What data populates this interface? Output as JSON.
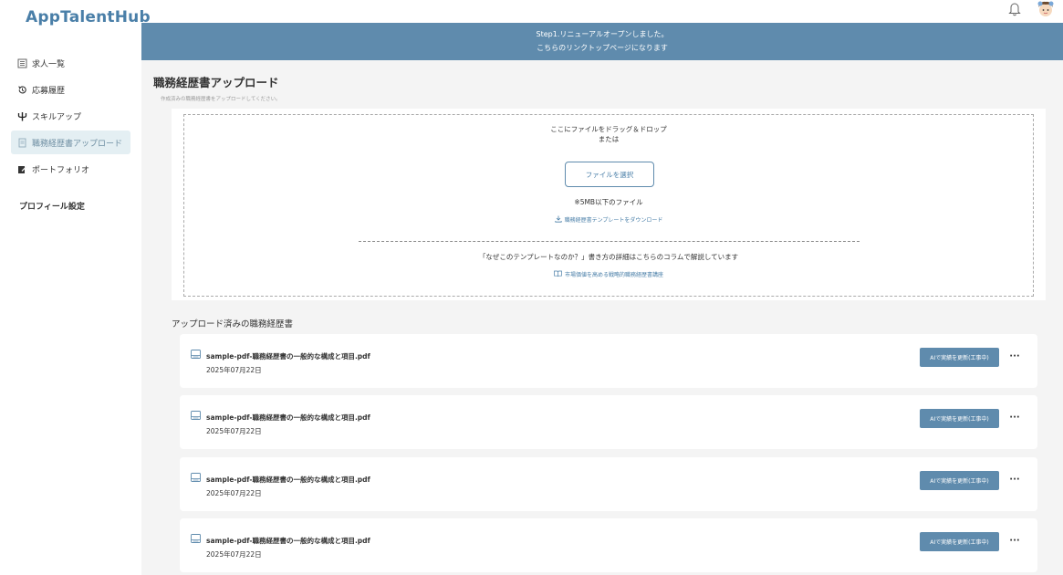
{
  "app": {
    "title": "AppTalentHub"
  },
  "sidebar": {
    "items": [
      {
        "label": "求人一覧",
        "icon": "building-icon"
      },
      {
        "label": "応募履歴",
        "icon": "history-icon"
      },
      {
        "label": "スキルアップ",
        "icon": "trident-icon"
      },
      {
        "label": "職務経歴書アップロード",
        "icon": "document-upload-icon",
        "active": true
      },
      {
        "label": "ポートフォリオ",
        "icon": "edit-icon"
      }
    ],
    "profile_label": "プロフィール設定"
  },
  "banner": {
    "line1": "Step1.リニューアルオープンしました。",
    "line2": "こちらのリンクトップページになります"
  },
  "page": {
    "title": "職務経歴書アップロード",
    "subtitle": "作成済みの職務経歴書をアップロードしてください。"
  },
  "upload": {
    "drag_text": "ここにファイルをドラッグ＆ドロップ",
    "or_text": "または",
    "select_button": "ファイルを選択",
    "limit_text": "※5MB以下のファイル",
    "template_link": "職務経歴書テンプレートをダウンロード",
    "why_text": "「なぜこのテンプレートなのか？」書き方の詳細はこちらのコラムで解説しています",
    "column_link": "市場価値を高める戦略的職務経歴書講座"
  },
  "uploaded": {
    "title": "アップロード済みの職務経歴書",
    "files": [
      {
        "name": "sample-pdf-職務経歴書の一般的な構成と項目.pdf",
        "date": "2025年07月22日",
        "action": "AIで実績を更新(工事中)",
        "more": "···"
      },
      {
        "name": "sample-pdf-職務経歴書の一般的な構成と項目.pdf",
        "date": "2025年07月22日",
        "action": "AIで実績を更新(工事中)",
        "more": "···"
      },
      {
        "name": "sample-pdf-職務経歴書の一般的な構成と項目.pdf",
        "date": "2025年07月22日",
        "action": "AIで実績を更新(工事中)",
        "more": "···"
      },
      {
        "name": "sample-pdf-職務経歴書の一般的な構成と項目.pdf",
        "date": "2025年07月22日",
        "action": "AIで実績を更新(工事中)",
        "more": "···"
      }
    ]
  },
  "colors": {
    "accent": "#5f8bad",
    "brand": "#4a7fa8",
    "active_bg": "#e4eff3",
    "page_bg": "#f4f4f4"
  }
}
